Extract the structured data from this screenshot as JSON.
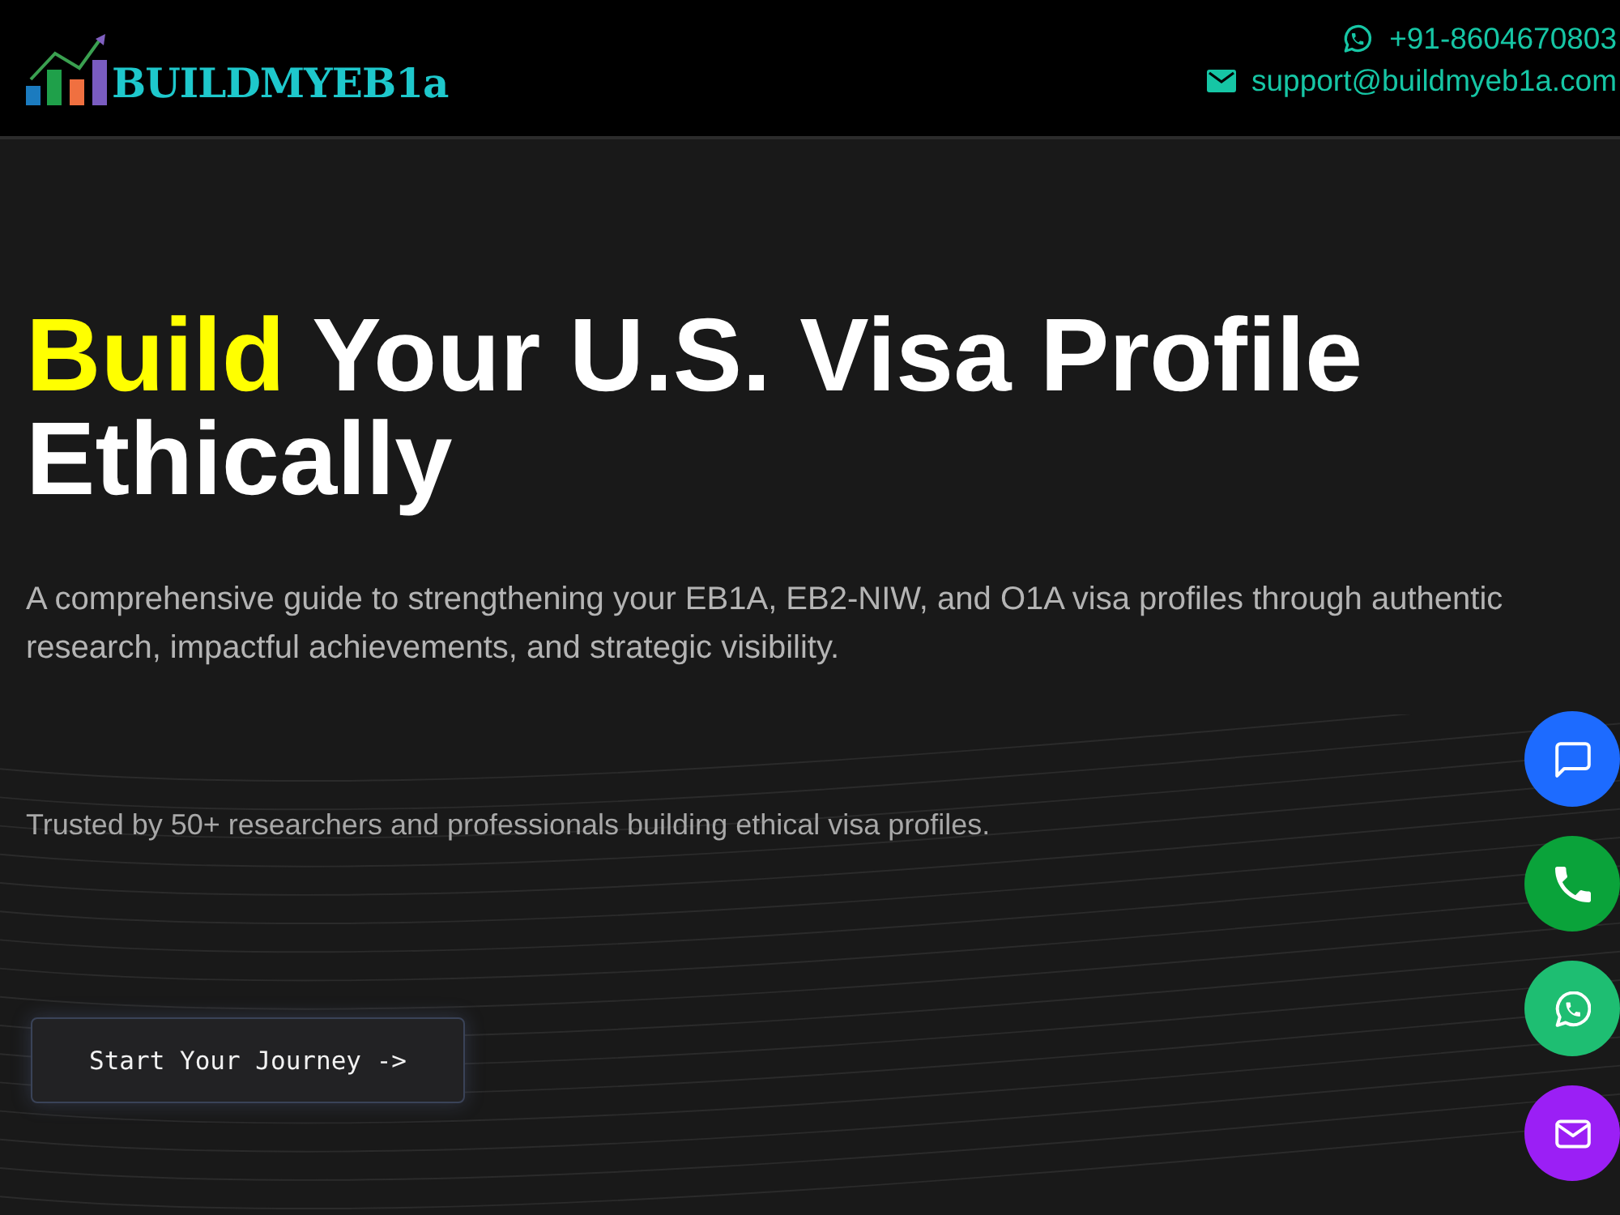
{
  "header": {
    "logo": {
      "text": "BUILDMYEB1a"
    },
    "contacts": [
      {
        "kind": "phone",
        "text": "+91-8604670803"
      },
      {
        "kind": "email",
        "text": "support@buildmyeb1a.com"
      }
    ]
  },
  "hero": {
    "heading": [
      {
        "text": "Build",
        "highlight": true
      },
      {
        "text": "Your U.S. Visa Profile Ethically",
        "highlight": false
      }
    ],
    "description": "A comprehensive guide to strengthening your EB1A, EB2-NIW, and O1A visa profiles through authentic research, impactful achievements, and strategic visibility.",
    "trust_note": "Trusted by 50+ researchers and professionals building ethical visa profiles.",
    "cta": {
      "label": "Start Your Journey ->"
    }
  },
  "floating_actions": [
    {
      "kind": "chat",
      "color": "#1d6bff"
    },
    {
      "kind": "call",
      "color": "#0aa33a"
    },
    {
      "kind": "whatsapp",
      "color": "#1ebe72"
    },
    {
      "kind": "email",
      "color": "#9b1ff5"
    }
  ]
}
